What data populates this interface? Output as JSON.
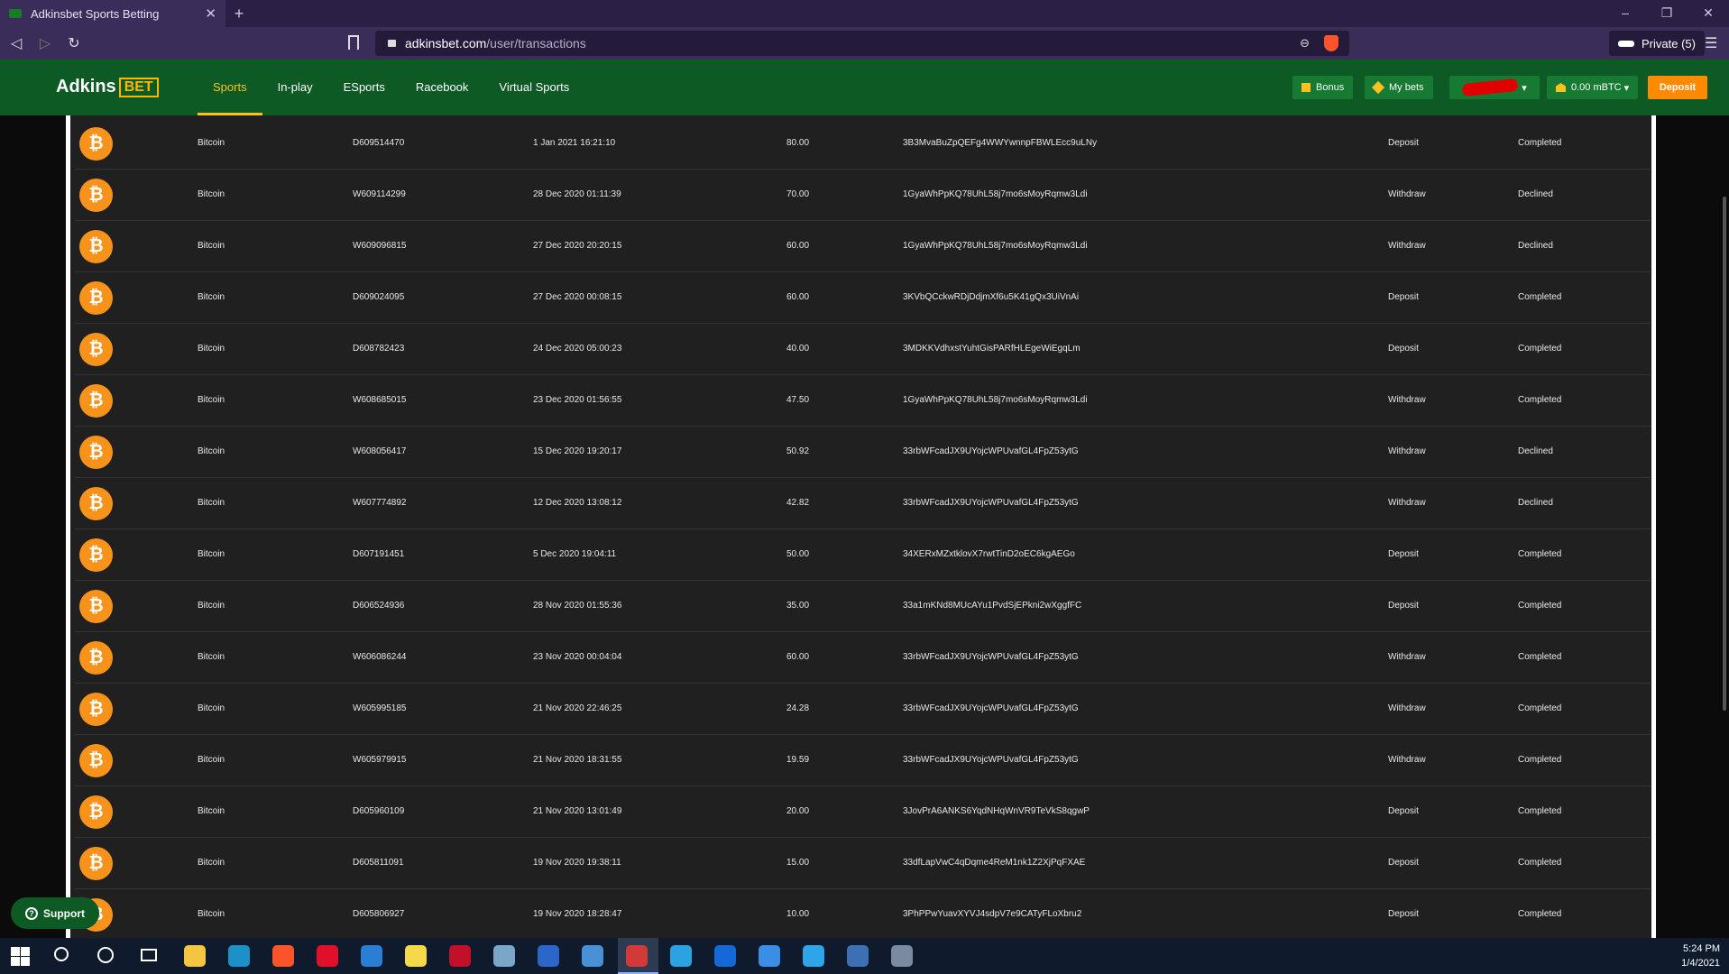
{
  "browser": {
    "tab_title": "Adkinsbet Sports Betting",
    "url_host": "adkinsbet.com",
    "url_path": "/user/transactions",
    "private_label": "Private (5)"
  },
  "site": {
    "logo_text": "Adkins",
    "logo_badge": "BET",
    "nav": [
      "Sports",
      "In-play",
      "ESports",
      "Racebook",
      "Virtual Sports"
    ],
    "bonus_label": "Bonus",
    "mybets_label": "My bets",
    "balance_label": "0.00 mBTC",
    "deposit_label": "Deposit",
    "accent_color": "#ffc21c",
    "header_color": "#0d5a24"
  },
  "transactions": [
    {
      "currency": "Bitcoin",
      "id": "D609514470",
      "date": "1 Jan 2021 16:21:10",
      "amount": "80.00",
      "address": "3B3MvaBuZpQEFg4WWYwnnpFBWLEcc9uLNy",
      "type": "Deposit",
      "status": "Completed"
    },
    {
      "currency": "Bitcoin",
      "id": "W609114299",
      "date": "28 Dec 2020 01:11:39",
      "amount": "70.00",
      "address": "1GyaWhPpKQ78UhL58j7mo6sMoyRqmw3Ldi",
      "type": "Withdraw",
      "status": "Declined"
    },
    {
      "currency": "Bitcoin",
      "id": "W609096815",
      "date": "27 Dec 2020 20:20:15",
      "amount": "60.00",
      "address": "1GyaWhPpKQ78UhL58j7mo6sMoyRqmw3Ldi",
      "type": "Withdraw",
      "status": "Declined"
    },
    {
      "currency": "Bitcoin",
      "id": "D609024095",
      "date": "27 Dec 2020 00:08:15",
      "amount": "60.00",
      "address": "3KVbQCckwRDjDdjmXf6u5K41gQx3UiVnAi",
      "type": "Deposit",
      "status": "Completed"
    },
    {
      "currency": "Bitcoin",
      "id": "D608782423",
      "date": "24 Dec 2020 05:00:23",
      "amount": "40.00",
      "address": "3MDKKVdhxstYuhtGisPARfHLEgeWiEgqLm",
      "type": "Deposit",
      "status": "Completed"
    },
    {
      "currency": "Bitcoin",
      "id": "W608685015",
      "date": "23 Dec 2020 01:56:55",
      "amount": "47.50",
      "address": "1GyaWhPpKQ78UhL58j7mo6sMoyRqmw3Ldi",
      "type": "Withdraw",
      "status": "Completed"
    },
    {
      "currency": "Bitcoin",
      "id": "W608056417",
      "date": "15 Dec 2020 19:20:17",
      "amount": "50.92",
      "address": "33rbWFcadJX9UYojcWPUvafGL4FpZ53ytG",
      "type": "Withdraw",
      "status": "Declined"
    },
    {
      "currency": "Bitcoin",
      "id": "W607774892",
      "date": "12 Dec 2020 13:08:12",
      "amount": "42.82",
      "address": "33rbWFcadJX9UYojcWPUvafGL4FpZ53ytG",
      "type": "Withdraw",
      "status": "Declined"
    },
    {
      "currency": "Bitcoin",
      "id": "D607191451",
      "date": "5 Dec 2020 19:04:11",
      "amount": "50.00",
      "address": "34XERxMZxtklovX7rwtTinD2oEC6kgAEGo",
      "type": "Deposit",
      "status": "Completed"
    },
    {
      "currency": "Bitcoin",
      "id": "D606524936",
      "date": "28 Nov 2020 01:55:36",
      "amount": "35.00",
      "address": "33a1mKNd8MUcAYu1PvdSjEPkni2wXggfFC",
      "type": "Deposit",
      "status": "Completed"
    },
    {
      "currency": "Bitcoin",
      "id": "W606086244",
      "date": "23 Nov 2020 00:04:04",
      "amount": "60.00",
      "address": "33rbWFcadJX9UYojcWPUvafGL4FpZ53ytG",
      "type": "Withdraw",
      "status": "Completed"
    },
    {
      "currency": "Bitcoin",
      "id": "W605995185",
      "date": "21 Nov 2020 22:46:25",
      "amount": "24.28",
      "address": "33rbWFcadJX9UYojcWPUvafGL4FpZ53ytG",
      "type": "Withdraw",
      "status": "Completed"
    },
    {
      "currency": "Bitcoin",
      "id": "W605979915",
      "date": "21 Nov 2020 18:31:55",
      "amount": "19.59",
      "address": "33rbWFcadJX9UYojcWPUvafGL4FpZ53ytG",
      "type": "Withdraw",
      "status": "Completed"
    },
    {
      "currency": "Bitcoin",
      "id": "D605960109",
      "date": "21 Nov 2020 13:01:49",
      "amount": "20.00",
      "address": "3JovPrA6ANKS6YqdNHqWnVR9TeVkS8qgwP",
      "type": "Deposit",
      "status": "Completed"
    },
    {
      "currency": "Bitcoin",
      "id": "D605811091",
      "date": "19 Nov 2020 19:38:11",
      "amount": "15.00",
      "address": "33dfLapVwC4qDqme4ReM1nk1Z2XjPqFXAE",
      "type": "Deposit",
      "status": "Completed"
    },
    {
      "currency": "Bitcoin",
      "id": "D605806927",
      "date": "19 Nov 2020 18:28:47",
      "amount": "10.00",
      "address": "3PhPPwYuavXYVJ4sdpV7e9CATyFLoXbru2",
      "type": "Deposit",
      "status": "Completed"
    }
  ],
  "support_label": "Support",
  "clock": {
    "time": "5:24 PM",
    "date": "1/4/2021"
  },
  "taskbar_apps": [
    {
      "name": "file-explorer-icon",
      "color": "#f4c542"
    },
    {
      "name": "edge-icon",
      "color": "#1e90c8"
    },
    {
      "name": "brave-icon",
      "color": "#fb542b"
    },
    {
      "name": "opera-icon",
      "color": "#e0102a"
    },
    {
      "name": "ccleaner-icon",
      "color": "#2a7fd4"
    },
    {
      "name": "sticky-notes-icon",
      "color": "#f6d94a"
    },
    {
      "name": "antivirus-icon",
      "color": "#c0102a"
    },
    {
      "name": "notepad-icon",
      "color": "#7aa6c8"
    },
    {
      "name": "word-icon",
      "color": "#2b66c8"
    },
    {
      "name": "browser-globe-icon",
      "color": "#4a90d6"
    },
    {
      "name": "active-app-icon",
      "color": "#d23a3a"
    },
    {
      "name": "telegram-icon",
      "color": "#2aa3e0"
    },
    {
      "name": "teamviewer-icon",
      "color": "#1469d6"
    },
    {
      "name": "chat-icon",
      "color": "#3a8ee6"
    },
    {
      "name": "skype-icon",
      "color": "#2ea5e8"
    },
    {
      "name": "vpn-icon",
      "color": "#3d6fb5"
    },
    {
      "name": "calculator-icon",
      "color": "#7a8aa0"
    }
  ]
}
